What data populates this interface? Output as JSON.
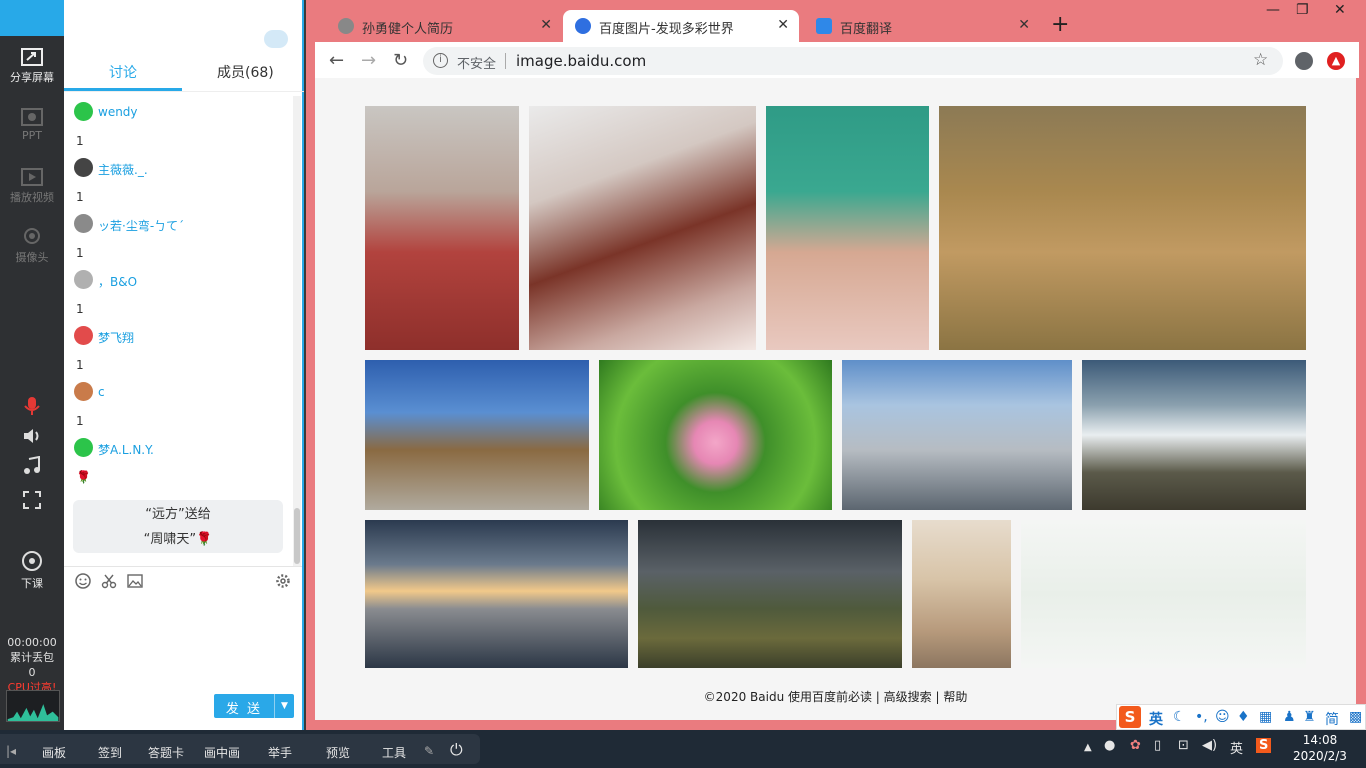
{
  "rail": {
    "share_screen": "分享屏幕",
    "ppt": "PPT",
    "play_video": "播放视频",
    "camera": "摄像头",
    "end_class": "下课",
    "timer": "00:00:00",
    "packet_loss_label": "累计丢包",
    "packet_loss_value": "0",
    "cpu_warning": "CPU过高!"
  },
  "chat": {
    "tab_discussion": "讨论",
    "tab_members": "成员(68)",
    "messages": [
      {
        "name": "wendy",
        "text": "1",
        "avatar_color": "#2cc44a"
      },
      {
        "name": "主薇薇._.",
        "text": "1",
        "avatar_color": "#444444"
      },
      {
        "name": "ッ若·尘弯-ㄅて´",
        "text": "1",
        "avatar_color": "#8a8a8a"
      },
      {
        "name": "，B&O",
        "text": "1",
        "avatar_color": "#b0b0b0"
      },
      {
        "name": "梦飞翔",
        "text": "1",
        "avatar_color": "#e24b4b"
      },
      {
        "name": "c",
        "text": "1",
        "avatar_color": "#c97b4a"
      },
      {
        "name": "梦A.L.N.Y.",
        "text": "🌹",
        "avatar_color": "#2cc44a"
      }
    ],
    "gift_line1": "“远方”送给",
    "gift_line2": "“周啸天”🌹",
    "send_label": "发 送"
  },
  "browser": {
    "tabs": [
      {
        "title": "孙勇健个人简历",
        "fav_color": "#888888"
      },
      {
        "title": "百度图片-发现多彩世界",
        "fav_color": "#2f6fe0"
      },
      {
        "title": "百度翻译",
        "fav_color": "#2f88e8"
      }
    ],
    "insecure_label": "不安全",
    "url": "image.baidu.com",
    "footer": "©2020 Baidu 使用百度前必读 | 高级搜索 | 帮助"
  },
  "gallery": [
    {
      "name": "runners",
      "bg": "linear-gradient(180deg,#c9c6c2 0%,#b9a59a 35%,#b2433e 60%,#8e2f2b 100%)"
    },
    {
      "name": "woman-bottle",
      "bg": "linear-gradient(160deg,#eaeaea 0%,#d4c8c2 30%,#7a3428 55%,#c9a8a0 80%,#f3e8e4 100%)"
    },
    {
      "name": "girl-pink-balls",
      "bg": "linear-gradient(180deg,#2f9b86 0%,#3aa890 35%,#d6a892 60%,#e9c9c0 100%)"
    },
    {
      "name": "lions",
      "bg": "linear-gradient(180deg,#8c7a55 0%,#a9884f 35%,#c19a62 60%,#8b7443 100%)"
    },
    {
      "name": "houses",
      "bg": "linear-gradient(180deg,#2e5fae 0%,#5a8fd2 35%,#8a6a42 60%,#b0aa9e 100%)"
    },
    {
      "name": "lotus",
      "bg": "radial-gradient(circle at 50% 55%,#f3a6c8 0%,#e687b4 15%,#3f8f2a 35%,#6bbd3b 70%,#2f7a1f 100%)"
    },
    {
      "name": "skyscrapers",
      "bg": "linear-gradient(180deg,#5f8fc9 0%,#a9c4e0 30%,#b6bcc2 60%,#5c6670 100%)"
    },
    {
      "name": "mountain-sheep",
      "bg": "linear-gradient(180deg,#3c5a78 0%,#8aa0ae 30%,#e9eef0 50%,#5b5a4a 75%,#3d3a2e 100%)"
    },
    {
      "name": "sunset-frame",
      "bg": "linear-gradient(180deg,#2b3a4f 0%,#6a7a8c 30%,#f2c98a 48%,#8a8c90 60%,#2c3746 100%)"
    },
    {
      "name": "viaduct",
      "bg": "linear-gradient(180deg,#2a3138 0%,#5a6167 35%,#4f5a3c 60%,#6b6a3c 80%,#3b3f2a 100%)"
    },
    {
      "name": "city-street",
      "bg": "linear-gradient(180deg,#e7dccd 0%,#d8c4a8 40%,#b79a7c 75%,#8c7660 100%)"
    },
    {
      "name": "ink-sketch",
      "bg": "linear-gradient(180deg,#f4f6f4 0%,#e9efe9 50%,#f4f6f4 100%)"
    }
  ],
  "ime": {
    "mode": "英",
    "icon": "S"
  },
  "taskbar": {
    "items": [
      "画板",
      "签到",
      "答题卡",
      "画中画",
      "举手",
      "预览",
      "工具"
    ],
    "tray_lang": "英",
    "time": "14:08",
    "date": "2020/2/3"
  }
}
